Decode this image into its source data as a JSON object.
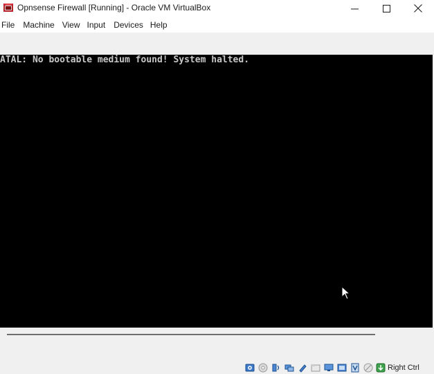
{
  "window": {
    "title": "Opnsense Firewall [Running] - Oracle VM VirtualBox"
  },
  "menu": {
    "items": [
      "File",
      "Machine",
      "View",
      "Input",
      "Devices",
      "Help"
    ]
  },
  "console": {
    "line1": "ATAL: No bootable medium found! System halted."
  },
  "statusbar": {
    "icons": [
      "hard-disk-icon",
      "optical-drive-icon",
      "audio-icon",
      "network-icon",
      "usb-icon",
      "shared-folders-icon",
      "display-icon",
      "video-capture-icon",
      "cpu-icon",
      "mouse-integration-icon",
      "host-key-arrow-icon"
    ],
    "host_key": "Right Ctrl"
  },
  "colors": {
    "vm_background": "#000000",
    "console_text": "#c8c8c8",
    "chrome_background": "#f0f0f0"
  }
}
